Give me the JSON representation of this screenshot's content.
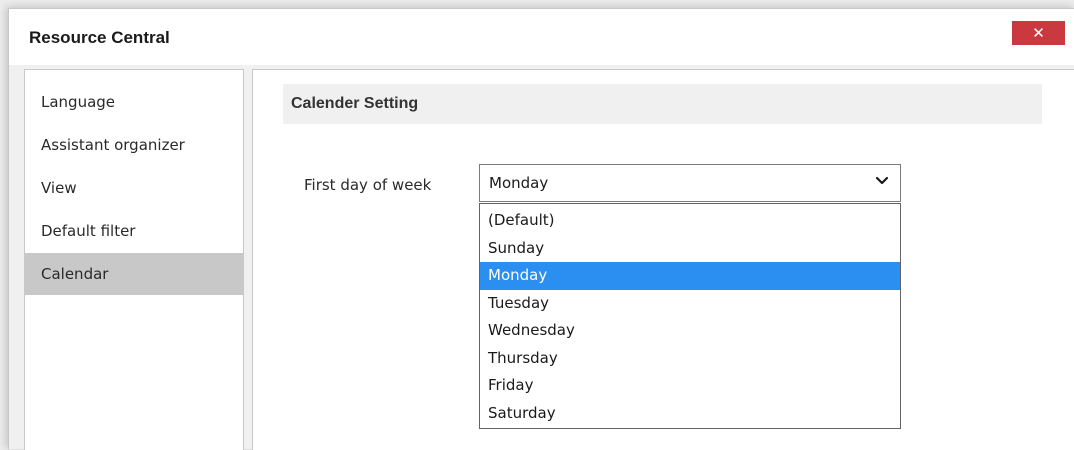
{
  "window": {
    "title": "Resource Central",
    "close_glyph": "✕"
  },
  "sidebar": {
    "items": [
      {
        "label": "Language",
        "selected": false
      },
      {
        "label": "Assistant organizer",
        "selected": false
      },
      {
        "label": "View",
        "selected": false
      },
      {
        "label": "Default filter",
        "selected": false
      },
      {
        "label": "Calendar",
        "selected": true
      }
    ]
  },
  "main": {
    "section_title": "Calender Setting",
    "first_day_field": {
      "label": "First day of week",
      "value": "Monday",
      "dropdown_open": true,
      "options": [
        "(Default)",
        "Sunday",
        "Monday",
        "Tuesday",
        "Wednesday",
        "Thursday",
        "Friday",
        "Saturday"
      ],
      "highlighted_option": "Monday"
    }
  },
  "colors": {
    "close_button": "#c9393f",
    "highlight": "#2a8ff0",
    "selected_nav": "#c8c8c8"
  },
  "icons": {
    "close": "close-icon",
    "dropdown": "chevron-down-icon"
  }
}
